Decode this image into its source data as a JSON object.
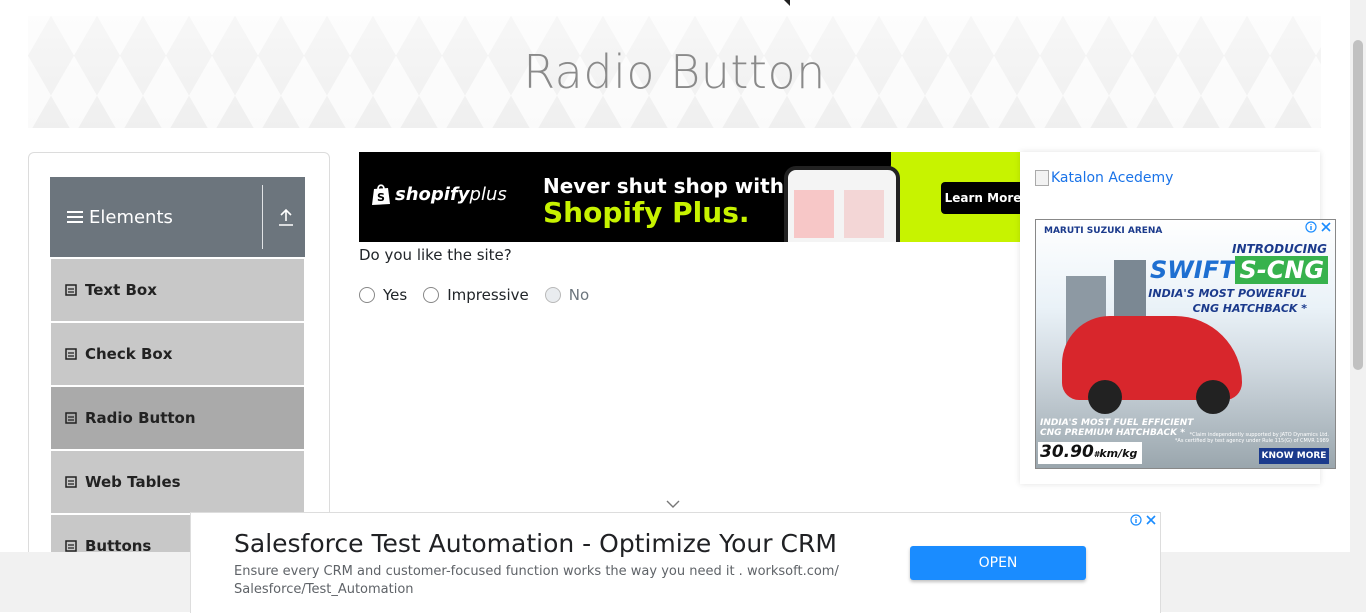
{
  "page": {
    "title": "Radio Button"
  },
  "sidebar": {
    "header": "Elements",
    "items": [
      {
        "label": "Text Box"
      },
      {
        "label": "Check Box"
      },
      {
        "label": "Radio Button",
        "active": true
      },
      {
        "label": "Web Tables"
      },
      {
        "label": "Buttons"
      }
    ]
  },
  "shopify_ad": {
    "brand_bold": "shopify",
    "brand_light": "plus",
    "headline_1": "Never shut shop with",
    "headline_2": "Shopify Plus.",
    "cta": "Learn More"
  },
  "question": {
    "text": "Do you like the site?",
    "options": [
      {
        "label": "Yes",
        "disabled": false
      },
      {
        "label": "Impressive",
        "disabled": false
      },
      {
        "label": "No",
        "disabled": true
      }
    ]
  },
  "right_ads": {
    "katalon_alt": "Katalon Acedemy",
    "maruti": {
      "brand": "MARUTI SUZUKI ARENA",
      "intro": "INTRODUCING",
      "model": "SWIFT",
      "variant": "S-CNG",
      "tagline_1": "INDIA'S MOST POWERFUL",
      "tagline_2": "CNG HATCHBACK *",
      "fuel_1": "INDIA'S MOST FUEL EFFICIENT",
      "fuel_2": "CNG PREMIUM HATCHBACK *",
      "claim_1": "*Claim independently supported by JATO Dynamics Ltd.",
      "claim_2": "*As certified by test agency under Rule 115(G) of CMVR 1989",
      "mileage": "30.90",
      "mileage_sup": "#",
      "mileage_unit": "km/kg",
      "cta": "KNOW MORE"
    }
  },
  "bottom_ad": {
    "headline": "Salesforce Test Automation - Optimize Your CRM",
    "description": "Ensure every CRM and customer-focused function works the way you need it . worksoft.com/ Salesforce/Test_Automation",
    "cta": "OPEN"
  },
  "colors": {
    "sidebar_header": "#6c757d",
    "menu_item": "#c8c8c8",
    "menu_item_active": "#aaaaaa",
    "shopify_green": "#c7f300",
    "open_button": "#1a8cff",
    "link": "#1a73e8"
  }
}
